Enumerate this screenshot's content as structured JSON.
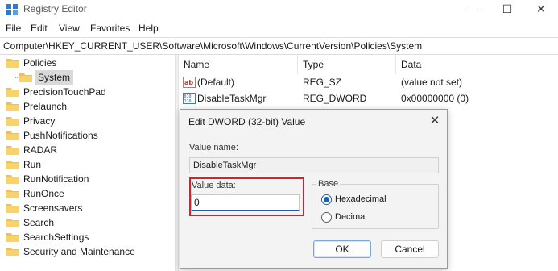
{
  "window": {
    "title": "Registry Editor"
  },
  "menu": [
    "File",
    "Edit",
    "View",
    "Favorites",
    "Help"
  ],
  "address": {
    "path": "Computer\\HKEY_CURRENT_USER\\Software\\Microsoft\\Windows\\CurrentVersion\\Policies\\System"
  },
  "tree": {
    "items": [
      {
        "label": "Policies"
      },
      {
        "label": "System",
        "selected": true
      },
      {
        "label": "PrecisionTouchPad"
      },
      {
        "label": "Prelaunch"
      },
      {
        "label": "Privacy"
      },
      {
        "label": "PushNotifications"
      },
      {
        "label": "RADAR"
      },
      {
        "label": "Run"
      },
      {
        "label": "RunNotification"
      },
      {
        "label": "RunOnce"
      },
      {
        "label": "Screensavers"
      },
      {
        "label": "Search"
      },
      {
        "label": "SearchSettings"
      },
      {
        "label": "Security and Maintenance"
      }
    ]
  },
  "list": {
    "columns": [
      "Name",
      "Type",
      "Data"
    ],
    "rows": [
      {
        "name": "(Default)",
        "type": "REG_SZ",
        "data": "(value not set)",
        "icon": "string-value-icon"
      },
      {
        "name": "DisableTaskMgr",
        "type": "REG_DWORD",
        "data": "0x00000000 (0)",
        "icon": "dword-value-icon"
      }
    ]
  },
  "dialog": {
    "title": "Edit DWORD (32-bit) Value",
    "value_name_label": "Value name:",
    "value_name": "DisableTaskMgr",
    "value_data_label": "Value data:",
    "value_data": "0",
    "base_label": "Base",
    "base_options": [
      {
        "label": "Hexadecimal",
        "checked": true
      },
      {
        "label": "Decimal",
        "checked": false
      }
    ],
    "ok_label": "OK",
    "cancel_label": "Cancel"
  },
  "colors": {
    "highlight_border": "#d5202e",
    "accent": "#1f5fb0",
    "folder": "#f3c14b"
  }
}
